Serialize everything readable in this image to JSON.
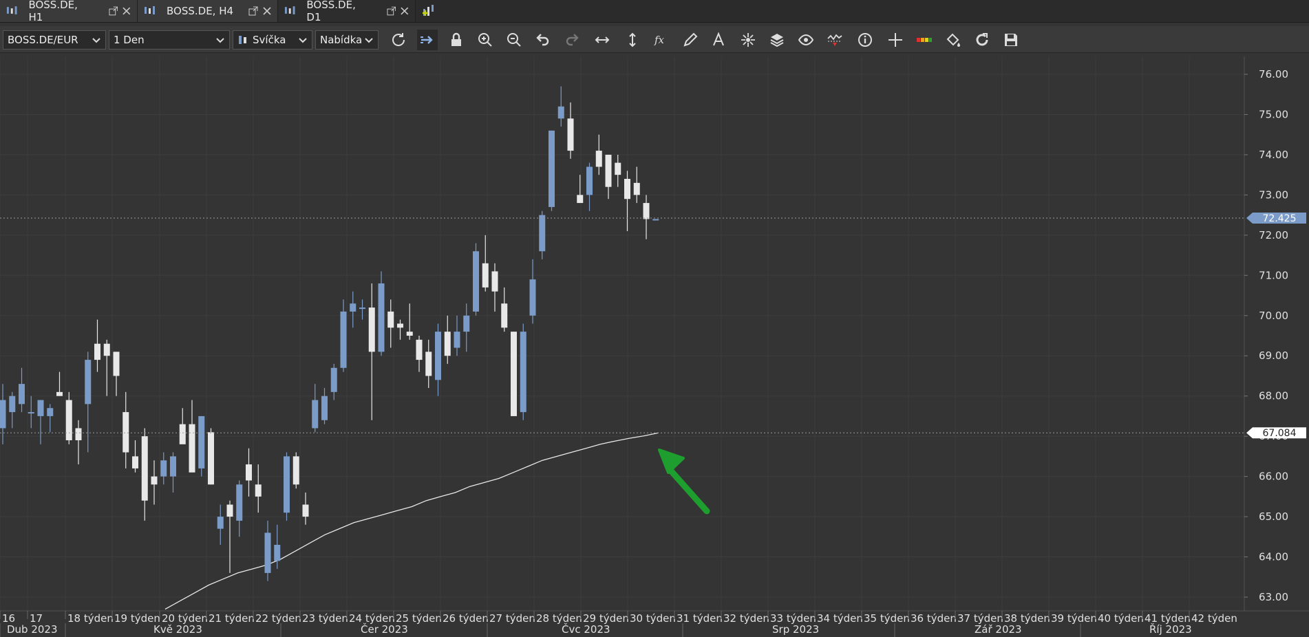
{
  "tabs": [
    {
      "label": "BOSS.DE, H1",
      "active": false
    },
    {
      "label": "BOSS.DE, H4",
      "active": false
    },
    {
      "label": "BOSS.DE, D1",
      "active": true
    }
  ],
  "toolbar": {
    "symbol": "BOSS.DE/EUR",
    "timeframe": "1 Den",
    "chart_type": "Svíčka",
    "price_side": "Nabídka",
    "tools": [
      "refresh-icon",
      "autoscroll-icon",
      "lock-icon",
      "zoom-in-icon",
      "zoom-out-icon",
      "undo-icon",
      "redo-icon",
      "horizontal-scale-icon",
      "vertical-scale-icon",
      "function-icon",
      "pencil-icon",
      "text-icon",
      "objects-icon",
      "layers-icon",
      "eye-icon",
      "alert-icon",
      "info-icon",
      "crosshair-icon",
      "color-scale-icon",
      "paint-bucket-icon",
      "reset-icon",
      "save-icon"
    ]
  },
  "colors": {
    "bull": "#7b9cc9",
    "bear": "#e8e8e8",
    "background": "#343434",
    "arrow": "#1e9e2e",
    "current_price_tag": "#7b9cc9"
  },
  "price_axis": {
    "ticks": [
      "76.00",
      "75.00",
      "74.00",
      "73.00",
      "72.00",
      "71.00",
      "70.00",
      "69.00",
      "68.00",
      "67.00",
      "66.00",
      "65.00",
      "64.00",
      "63.00"
    ],
    "current_price": "72.425",
    "ma_value": "67.084"
  },
  "time_axis": {
    "weeks": [
      "16",
      "17",
      "18 týden",
      "19 týden",
      "20 týden",
      "21 týden",
      "22 týden",
      "23 týden",
      "24 týden",
      "25 týden",
      "26 týden",
      "27 týden",
      "28 týden",
      "29 týden",
      "30 týden",
      "31 týden",
      "32 týden",
      "33 týden",
      "34 týden",
      "35 týden",
      "36 týden",
      "37 týden",
      "38 týden",
      "39 týden",
      "40 týden",
      "41 týden",
      "42 týden"
    ],
    "months": [
      "Dub 2023",
      "Kvě 2023",
      "Čer 2023",
      "Čvc 2023",
      "Srp 2023",
      "Zář 2023",
      "Říj 2023"
    ]
  },
  "chart_data": {
    "type": "candlestick",
    "ylim": [
      62.6,
      76.6
    ],
    "grid": true,
    "candles": [
      {
        "o": 67.2,
        "h": 68.3,
        "l": 66.8,
        "c": 67.9
      },
      {
        "o": 67.6,
        "h": 68.1,
        "l": 67.2,
        "c": 68.0
      },
      {
        "o": 67.8,
        "h": 68.7,
        "l": 67.6,
        "c": 68.3
      },
      {
        "o": 67.6,
        "h": 68.0,
        "l": 67.2,
        "c": 67.6
      },
      {
        "o": 67.5,
        "h": 67.9,
        "l": 66.8,
        "c": 67.9
      },
      {
        "o": 67.5,
        "h": 67.8,
        "l": 67.1,
        "c": 67.7
      },
      {
        "o": 68.1,
        "h": 68.6,
        "l": 68.0,
        "c": 68.0
      },
      {
        "o": 67.9,
        "h": 68.1,
        "l": 66.8,
        "c": 66.9
      },
      {
        "o": 67.2,
        "h": 67.4,
        "l": 66.3,
        "c": 66.9
      },
      {
        "o": 67.8,
        "h": 69.1,
        "l": 66.6,
        "c": 68.9
      },
      {
        "o": 69.3,
        "h": 69.9,
        "l": 68.6,
        "c": 68.9
      },
      {
        "o": 69.3,
        "h": 69.4,
        "l": 68.0,
        "c": 69.0
      },
      {
        "o": 69.1,
        "h": 69.1,
        "l": 68.0,
        "c": 68.5
      },
      {
        "o": 67.6,
        "h": 68.1,
        "l": 66.2,
        "c": 66.6
      },
      {
        "o": 66.5,
        "h": 66.9,
        "l": 66.1,
        "c": 66.2
      },
      {
        "o": 67.0,
        "h": 67.2,
        "l": 64.9,
        "c": 65.4
      },
      {
        "o": 66.0,
        "h": 66.4,
        "l": 65.3,
        "c": 65.8
      },
      {
        "o": 66.0,
        "h": 66.6,
        "l": 65.8,
        "c": 66.4
      },
      {
        "o": 66.0,
        "h": 66.6,
        "l": 65.6,
        "c": 66.5
      },
      {
        "o": 67.3,
        "h": 67.7,
        "l": 67.1,
        "c": 66.8
      },
      {
        "o": 67.3,
        "h": 67.9,
        "l": 66.5,
        "c": 66.1
      },
      {
        "o": 66.2,
        "h": 67.5,
        "l": 66.0,
        "c": 67.5
      },
      {
        "o": 67.1,
        "h": 67.2,
        "l": 65.8,
        "c": 65.8
      },
      {
        "o": 64.7,
        "h": 65.3,
        "l": 64.3,
        "c": 65.0
      },
      {
        "o": 65.3,
        "h": 65.4,
        "l": 63.6,
        "c": 65.0
      },
      {
        "o": 64.9,
        "h": 65.9,
        "l": 64.5,
        "c": 65.8
      },
      {
        "o": 66.3,
        "h": 66.7,
        "l": 65.5,
        "c": 65.9
      },
      {
        "o": 65.8,
        "h": 66.3,
        "l": 65.1,
        "c": 65.5
      },
      {
        "o": 63.6,
        "h": 64.9,
        "l": 63.4,
        "c": 64.6
      },
      {
        "o": 63.9,
        "h": 64.8,
        "l": 63.7,
        "c": 64.3
      },
      {
        "o": 65.1,
        "h": 66.6,
        "l": 64.9,
        "c": 66.5
      },
      {
        "o": 66.5,
        "h": 66.6,
        "l": 65.7,
        "c": 65.8
      },
      {
        "o": 65.3,
        "h": 65.6,
        "l": 64.8,
        "c": 65.0
      },
      {
        "o": 67.2,
        "h": 68.3,
        "l": 67.1,
        "c": 67.9
      },
      {
        "o": 67.4,
        "h": 68.2,
        "l": 67.3,
        "c": 68.0
      },
      {
        "o": 68.1,
        "h": 68.8,
        "l": 67.9,
        "c": 68.7
      },
      {
        "o": 68.7,
        "h": 70.4,
        "l": 68.6,
        "c": 70.1
      },
      {
        "o": 70.1,
        "h": 70.6,
        "l": 69.7,
        "c": 70.3
      },
      {
        "o": 70.2,
        "h": 70.4,
        "l": 69.9,
        "c": 70.2
      },
      {
        "o": 70.2,
        "h": 70.8,
        "l": 67.4,
        "c": 69.1
      },
      {
        "o": 69.1,
        "h": 71.1,
        "l": 69.0,
        "c": 70.8
      },
      {
        "o": 70.1,
        "h": 70.4,
        "l": 69.2,
        "c": 69.7
      },
      {
        "o": 69.8,
        "h": 69.9,
        "l": 69.4,
        "c": 69.7
      },
      {
        "o": 69.6,
        "h": 70.3,
        "l": 69.4,
        "c": 69.5
      },
      {
        "o": 69.4,
        "h": 69.5,
        "l": 68.6,
        "c": 68.9
      },
      {
        "o": 69.1,
        "h": 69.4,
        "l": 68.2,
        "c": 68.5
      },
      {
        "o": 68.4,
        "h": 69.8,
        "l": 68.0,
        "c": 69.6
      },
      {
        "o": 69.6,
        "h": 70.0,
        "l": 68.8,
        "c": 69.0
      },
      {
        "o": 69.2,
        "h": 70.0,
        "l": 69.0,
        "c": 69.6
      },
      {
        "o": 69.6,
        "h": 70.3,
        "l": 69.1,
        "c": 70.0
      },
      {
        "o": 70.1,
        "h": 71.8,
        "l": 70.0,
        "c": 71.6
      },
      {
        "o": 71.3,
        "h": 72.0,
        "l": 70.6,
        "c": 70.7
      },
      {
        "o": 71.1,
        "h": 71.3,
        "l": 70.1,
        "c": 70.6
      },
      {
        "o": 70.3,
        "h": 70.7,
        "l": 69.6,
        "c": 69.7
      },
      {
        "o": 69.6,
        "h": 69.6,
        "l": 67.5,
        "c": 67.5
      },
      {
        "o": 67.6,
        "h": 69.8,
        "l": 67.4,
        "c": 69.6
      },
      {
        "o": 70.0,
        "h": 71.4,
        "l": 69.8,
        "c": 70.9
      },
      {
        "o": 71.6,
        "h": 72.6,
        "l": 71.4,
        "c": 72.5
      },
      {
        "o": 72.7,
        "h": 74.6,
        "l": 72.6,
        "c": 74.6
      },
      {
        "o": 74.9,
        "h": 75.7,
        "l": 74.7,
        "c": 75.2
      },
      {
        "o": 74.9,
        "h": 75.3,
        "l": 73.9,
        "c": 74.1
      },
      {
        "o": 73.0,
        "h": 73.5,
        "l": 72.8,
        "c": 72.8
      },
      {
        "o": 73.0,
        "h": 73.8,
        "l": 72.6,
        "c": 73.7
      },
      {
        "o": 74.1,
        "h": 74.5,
        "l": 73.5,
        "c": 73.7
      },
      {
        "o": 74.0,
        "h": 74.0,
        "l": 72.9,
        "c": 73.2
      },
      {
        "o": 73.8,
        "h": 74.0,
        "l": 73.2,
        "c": 73.5
      },
      {
        "o": 73.4,
        "h": 73.6,
        "l": 72.1,
        "c": 72.9
      },
      {
        "o": 73.3,
        "h": 73.7,
        "l": 72.8,
        "c": 73.0
      },
      {
        "o": 72.8,
        "h": 73.0,
        "l": 71.9,
        "c": 72.4
      },
      {
        "o": 72.4,
        "h": 72.4,
        "l": 72.4,
        "c": 72.4
      }
    ],
    "ma": [
      62.7,
      62.9,
      63.1,
      63.3,
      63.45,
      63.6,
      63.7,
      63.8,
      63.95,
      64.15,
      64.35,
      64.55,
      64.7,
      64.85,
      64.95,
      65.05,
      65.15,
      65.25,
      65.4,
      65.5,
      65.6,
      65.75,
      65.85,
      65.95,
      66.1,
      66.25,
      66.4,
      66.5,
      66.6,
      66.7,
      66.8,
      66.88,
      66.95,
      67.01,
      67.084
    ]
  }
}
